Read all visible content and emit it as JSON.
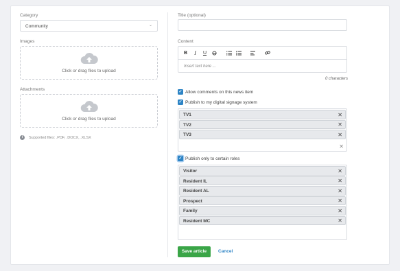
{
  "form": {
    "category_label": "Category",
    "category_value": "Community",
    "images_label": "Images",
    "images_upload_text": "Click or drag files to upload",
    "attachments_label": "Attachments",
    "attachments_upload_text": "Click or drag files to upload",
    "supported_files": "Supported files: .PDF, .DOCX, .XLSX",
    "title_label": "Title (optional)",
    "title_value": "",
    "content_label": "Content",
    "content_placeholder": "Insert text here ...",
    "char_count": "0 characters",
    "allow_comments_label": "Allow comments on this news item",
    "publish_signage_label": "Publish to my digital signage system",
    "signage_tags": [
      "TV1",
      "TV2",
      "TV3"
    ],
    "publish_roles_label": "Publish only to certain roles",
    "role_tags": [
      "Visitor",
      "Resident IL",
      "Resident AL",
      "Prospect",
      "Family",
      "Resident MC"
    ],
    "save_label": "Save article",
    "cancel_label": "Cancel"
  },
  "toolbar": {
    "buttons": [
      "bold-icon",
      "italic-icon",
      "underline-icon",
      "strikethrough-icon",
      "ordered-list-icon",
      "bullet-list-icon",
      "align-left-icon",
      "link-icon"
    ]
  },
  "colors": {
    "accent": "#2d84c5",
    "save": "#3aa547",
    "background": "#f0f1f4"
  },
  "checkboxes": {
    "allow_comments": true,
    "publish_signage": true,
    "publish_roles": true
  }
}
